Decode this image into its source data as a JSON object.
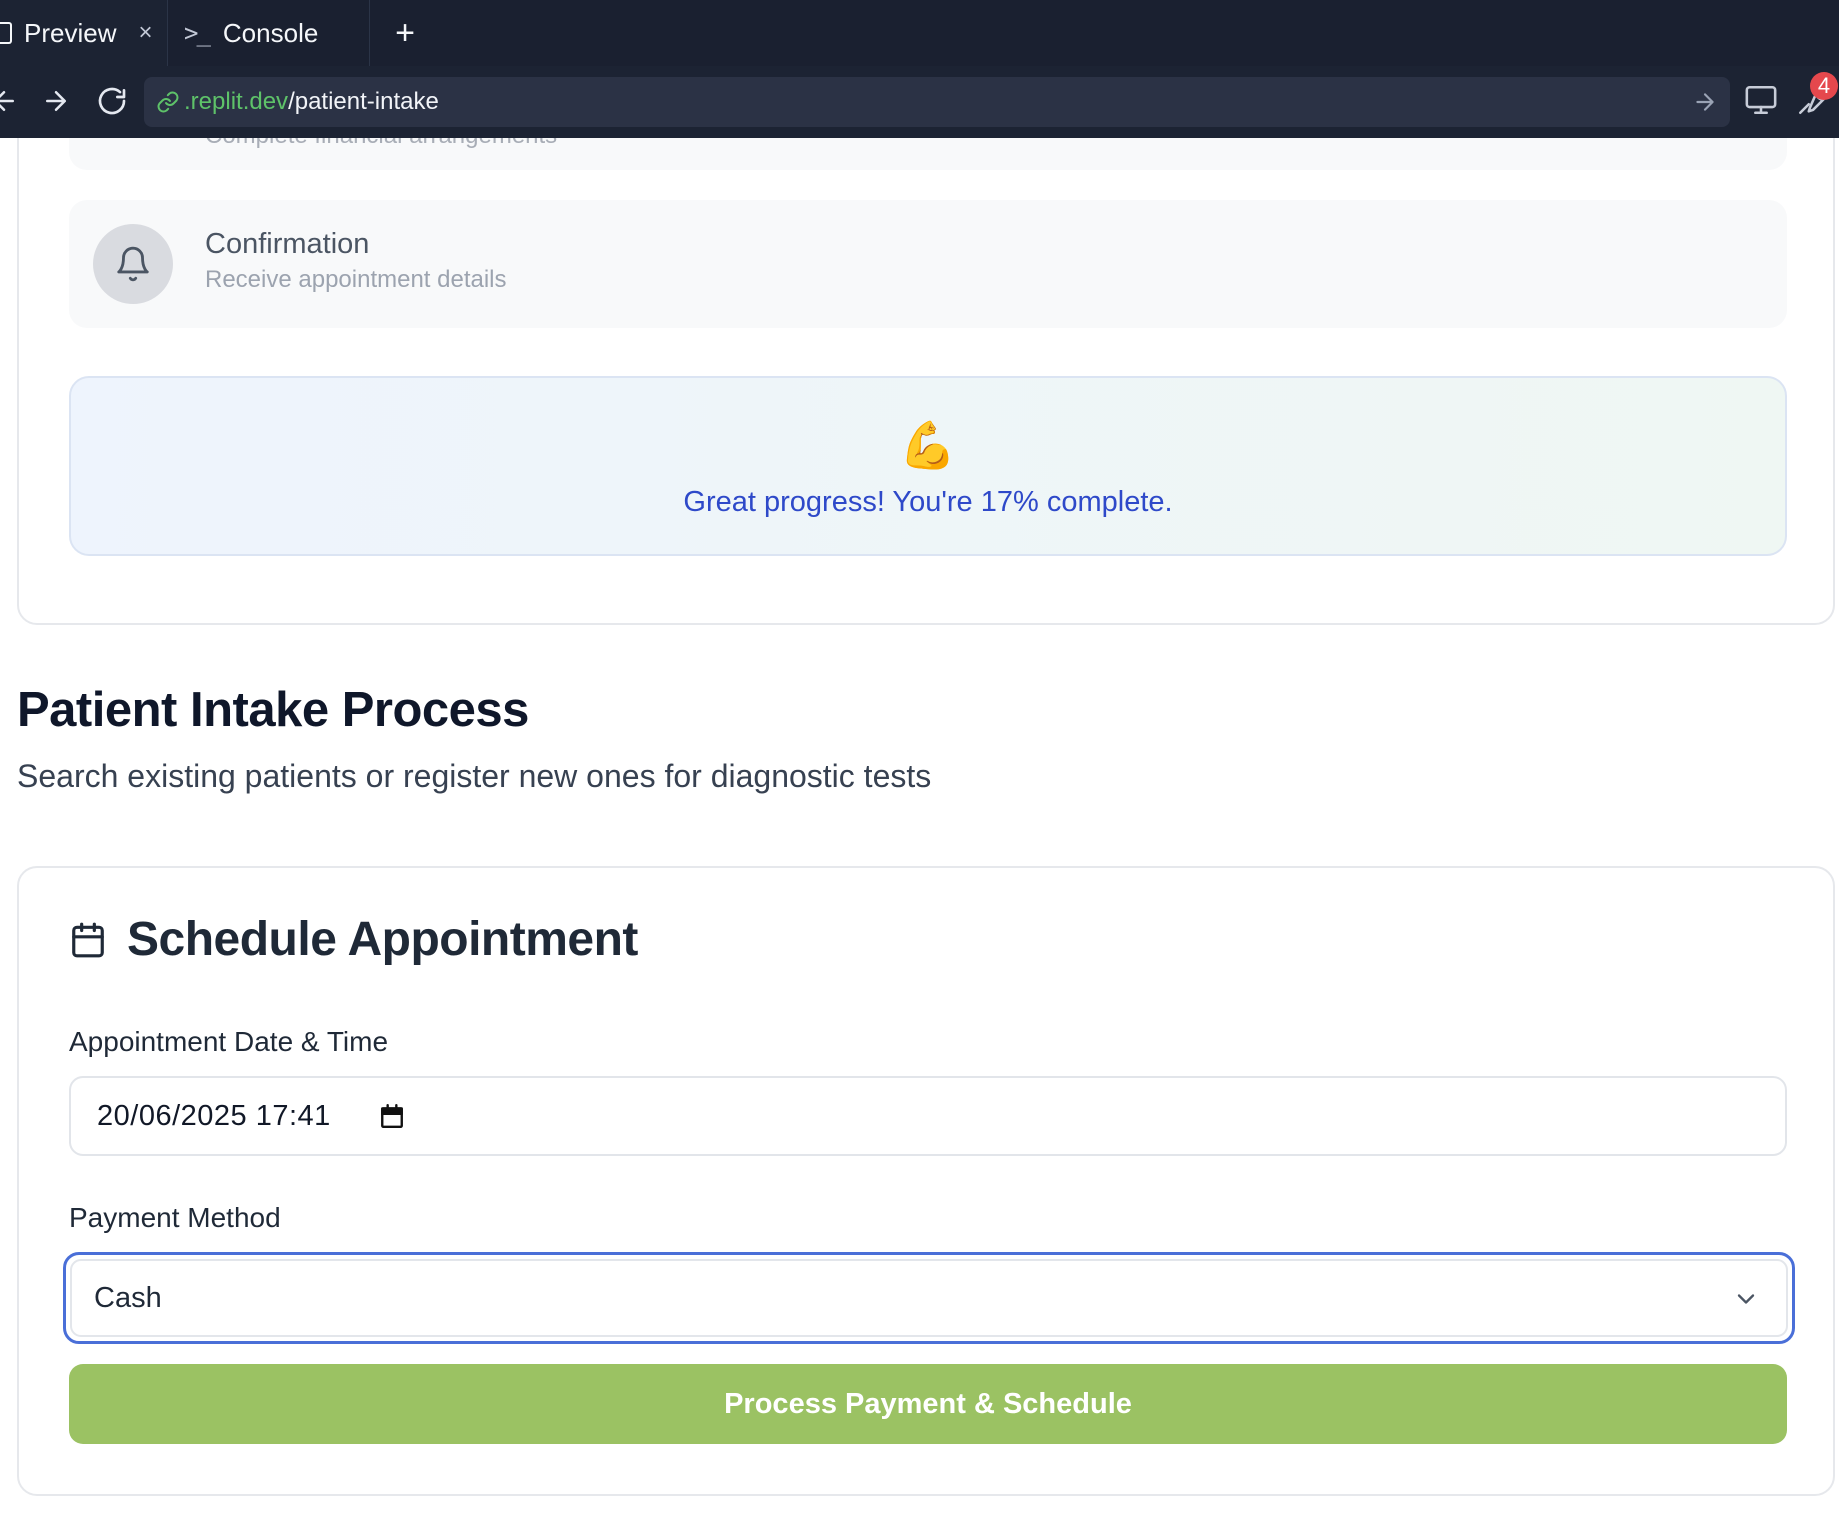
{
  "browser": {
    "tabs": [
      {
        "label": "Preview",
        "close": "×"
      },
      {
        "label": "Console"
      }
    ],
    "add_tab": "+",
    "url": {
      "domain": ".replit.dev",
      "path": "/patient-intake"
    },
    "devtools_badge": "4"
  },
  "progress": {
    "partial_step": {
      "description": "Complete financial arrangements"
    },
    "confirmation_step": {
      "title": "Confirmation",
      "description": "Receive appointment details"
    },
    "encouragement": {
      "emoji": "💪",
      "message": "Great progress! You're 17% complete.",
      "percent_complete": 17
    }
  },
  "page": {
    "title": "Patient Intake Process",
    "subtitle": "Search existing patients or register new ones for diagnostic tests"
  },
  "schedule": {
    "title": "Schedule Appointment",
    "date_label": "Appointment Date & Time",
    "date_value": "20/06/2025 17:41",
    "payment_label": "Payment Method",
    "payment_value": "Cash",
    "submit_label": "Process Payment & Schedule"
  },
  "colors": {
    "chrome_bg": "#1c2333",
    "url_domain": "#5ec269",
    "accent_blue": "#2e49c9",
    "focus_ring": "#4a6fd8",
    "submit_bg": "#9bc263",
    "badge": "#e5484d"
  },
  "icons": {
    "preview_tab": "preview-icon",
    "console_tab": "terminal-icon",
    "back": "arrow-left-icon",
    "forward": "arrow-right-icon",
    "reload": "reload-icon",
    "link": "link-icon",
    "go": "arrow-right-icon",
    "devices": "monitor-icon",
    "devtools": "wrench-icon",
    "confirmation_step": "bell-icon",
    "schedule": "calendar-icon",
    "select": "chevron-down-icon"
  }
}
